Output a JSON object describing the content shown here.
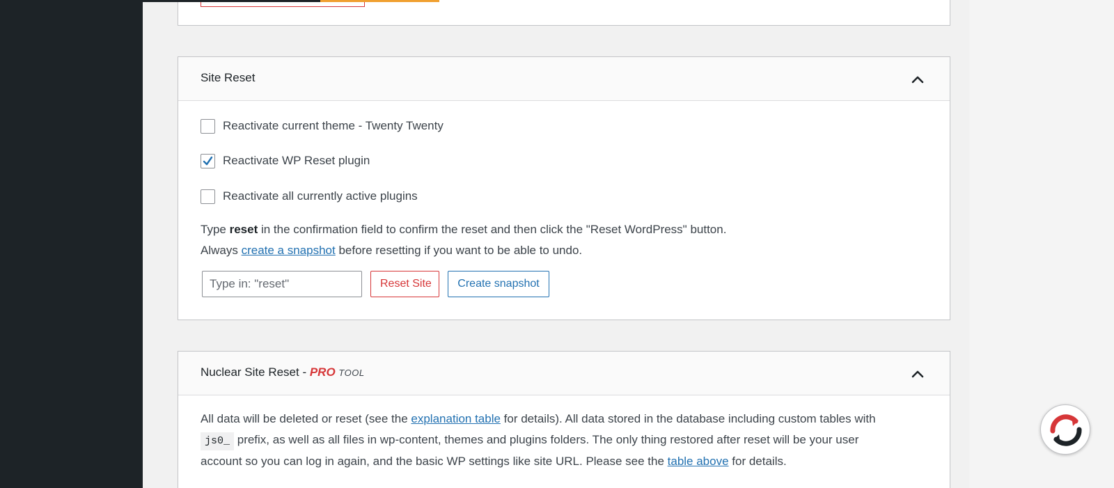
{
  "site_reset": {
    "title": "Site Reset",
    "options": [
      {
        "label": "Reactivate current theme - Twenty Twenty",
        "checked": false
      },
      {
        "label": "Reactivate WP Reset plugin",
        "checked": true
      },
      {
        "label": "Reactivate all currently active plugins",
        "checked": false
      }
    ],
    "instruction": {
      "prefix": "Type ",
      "keyword": "reset",
      "suffix": " in the confirmation field to confirm the reset and then click the \"Reset WordPress\" button."
    },
    "snapshot_note": {
      "prefix": "Always ",
      "link": "create a snapshot",
      "suffix": " before resetting if you want to be able to undo."
    },
    "confirm_placeholder": "Type in: \"reset\"",
    "reset_button": "Reset Site",
    "snapshot_button": "Create snapshot"
  },
  "nuclear_reset": {
    "title_main": "Nuclear Site Reset - ",
    "title_pro": "PRO",
    "title_tool": "TOOL",
    "desc_1a": "All data will be deleted or reset (see the ",
    "desc_1_link": "explanation table",
    "desc_1b": " for details). All data stored in the database including custom tables with",
    "prefix_code": "js0_",
    "desc_2": " prefix, as well as all files in wp-content, themes and plugins folders. The only thing restored after reset will be your user",
    "desc_3a": "account so you can log in again, and the basic WP settings like site URL. Please see the ",
    "desc_3_link": "table above",
    "desc_3b": " for details."
  },
  "colors": {
    "sidebar": "#1d2327",
    "link": "#2271b1",
    "danger": "#d63638",
    "accent_orange": "#f0a030"
  },
  "icons": {
    "collapse": "chevron-up-icon",
    "fab": "refresh-icon"
  }
}
